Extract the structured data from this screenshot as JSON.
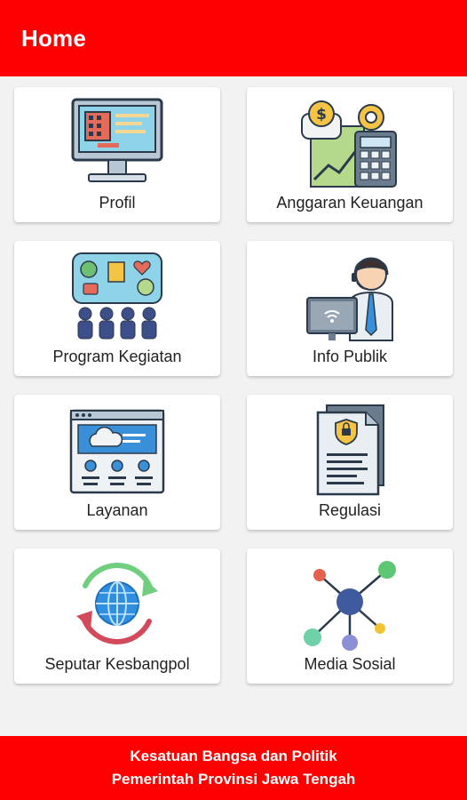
{
  "header": {
    "title": "Home"
  },
  "menu": [
    {
      "label": "Profil",
      "icon": "computer-monitor-icon"
    },
    {
      "label": "Anggaran Keuangan",
      "icon": "budget-calculator-icon"
    },
    {
      "label": "Program Kegiatan",
      "icon": "program-board-icon"
    },
    {
      "label": "Info Publik",
      "icon": "customer-service-icon"
    },
    {
      "label": "Layanan",
      "icon": "web-service-icon"
    },
    {
      "label": "Regulasi",
      "icon": "document-shield-icon"
    },
    {
      "label": "Seputar Kesbangpol",
      "icon": "globe-refresh-icon"
    },
    {
      "label": "Media Sosial",
      "icon": "network-nodes-icon"
    }
  ],
  "footer": {
    "line1": "Kesatuan Bangsa dan Politik",
    "line2": "Pemerintah Provinsi Jawa Tengah"
  },
  "colors": {
    "primary": "#ff0000",
    "background": "#f2f2f2",
    "card": "#ffffff"
  }
}
